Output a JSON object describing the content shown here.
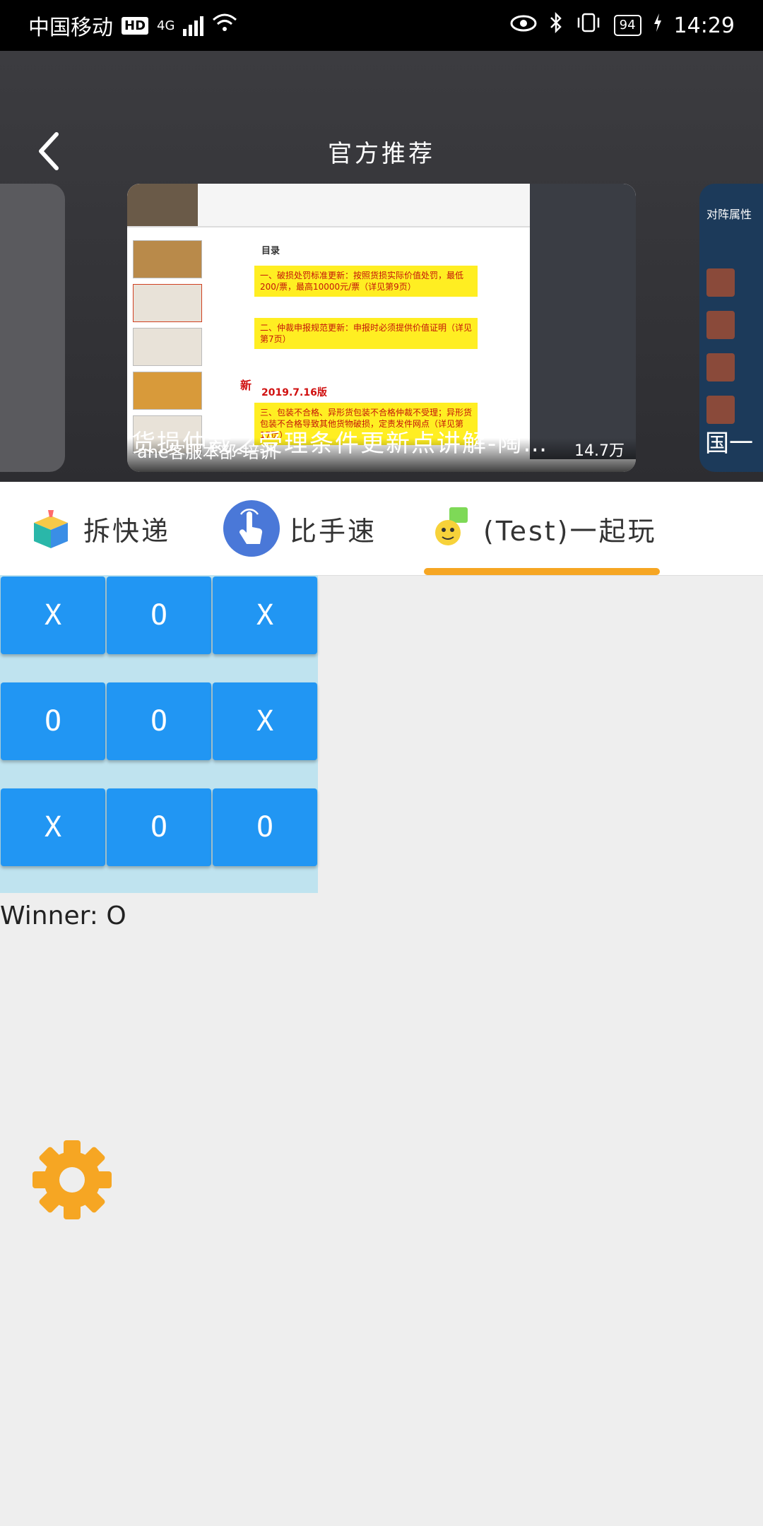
{
  "status_bar": {
    "carrier": "中国移动",
    "hd": "HD",
    "network": "4G",
    "battery": "94",
    "time": "14:29"
  },
  "header": {
    "title": "官方推荐",
    "featured_card": {
      "title": "货损仲裁之受理条件更新点讲解-陶…",
      "caption": "ane客服本部-培训",
      "views": "14.7万",
      "slide": {
        "heading": "目录",
        "item1": "一、破损处罚标准更新：按照货损实际价值处罚，最低200/票，最高10000元/票（详见第9页）",
        "item2": "二、仲裁申报规范更新：申报时必须提供价值证明（详见第7页）",
        "new_tag": "新",
        "version": "2019.7.16版",
        "item3": "三、包装不合格、异形货包装不合格仲裁不受理；异形货包装不合格导致其他货物破损，定责发件网点（详见第17页）"
      }
    },
    "next_card": {
      "title": "国一",
      "panel_title": "对阵属性"
    }
  },
  "tabs": [
    {
      "label": "拆快递",
      "icon": "gift-box-icon"
    },
    {
      "label": "比手速",
      "icon": "tap-hand-icon"
    },
    {
      "label": "(Test)一起玩",
      "icon": "mascot-icon",
      "active": true
    }
  ],
  "accent_color": "#f6a623",
  "cell_color": "#2196f3",
  "board": [
    [
      "X",
      "O",
      "X"
    ],
    [
      "O",
      "O",
      "X"
    ],
    [
      "X",
      "O",
      "O"
    ]
  ],
  "winner_text": "Winner: O"
}
